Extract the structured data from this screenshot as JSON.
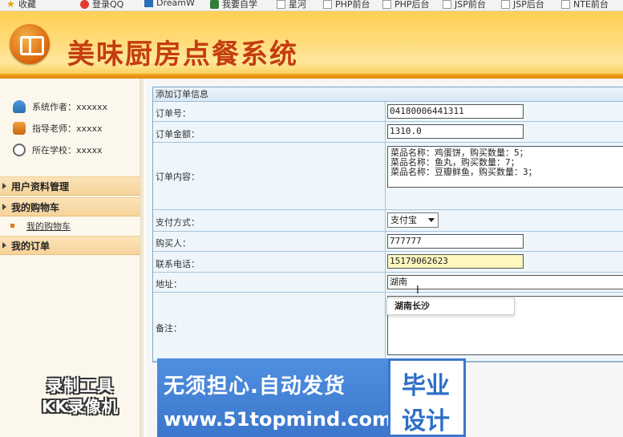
{
  "bookmarks": [
    {
      "label": "收藏",
      "icon": "star-icon"
    },
    {
      "label": "登录QQ",
      "icon": "qq-icon"
    },
    {
      "label": "DreamW",
      "icon": "dreamweaver-icon"
    },
    {
      "label": "我要自学",
      "icon": "shield-icon"
    },
    {
      "label": "星河",
      "icon": "doc-icon"
    },
    {
      "label": "PHP前台",
      "icon": "doc-icon"
    },
    {
      "label": "PHP后台",
      "icon": "doc-icon"
    },
    {
      "label": "JSP前台",
      "icon": "doc-icon"
    },
    {
      "label": "JSP后台",
      "icon": "doc-icon"
    },
    {
      "label": "NTE前台",
      "icon": "doc-icon"
    }
  ],
  "header": {
    "title": "美味厨房点餐系统"
  },
  "sidebar": {
    "info": [
      {
        "label": "系统作者：xxxxxx",
        "icon": "users-icon"
      },
      {
        "label": "指导老师：xxxxx",
        "icon": "teacher-icon"
      },
      {
        "label": "所在学校：xxxxx",
        "icon": "clock-icon"
      }
    ],
    "menu": [
      {
        "label": "用户资料管理"
      },
      {
        "label": "我的购物车",
        "sub": [
          "我的购物车"
        ]
      },
      {
        "label": "我的订单"
      }
    ]
  },
  "form": {
    "title": "添加订单信息",
    "fields": {
      "order_no": {
        "label": "订单号：",
        "value": "04180006441311"
      },
      "amount": {
        "label": "订单金额：",
        "value": "1310.0"
      },
      "content": {
        "label": "订单内容：",
        "lines": [
          "菜品名称：鸡蛋饼，购买数量：5；",
          "菜品名称：鱼丸，购买数量：7；",
          "菜品名称：豆瓣鲜鱼，购买数量：3；"
        ]
      },
      "payment": {
        "label": "支付方式：",
        "value": "支付宝"
      },
      "buyer": {
        "label": "购买人：",
        "value": "777777"
      },
      "phone": {
        "label": "联系电话：",
        "value": "15179062623"
      },
      "address": {
        "label": "地址：",
        "value": "湖南"
      },
      "remark": {
        "label": "备注：",
        "value": ""
      }
    },
    "autocomplete": "湖南长沙"
  },
  "watermark": {
    "line1": "录制工具",
    "line2": "KK录像机"
  },
  "ad": {
    "line1": "无须担心.自动发货",
    "line2": "www.51topmind.com",
    "box1": "毕业",
    "box2": "设计"
  }
}
